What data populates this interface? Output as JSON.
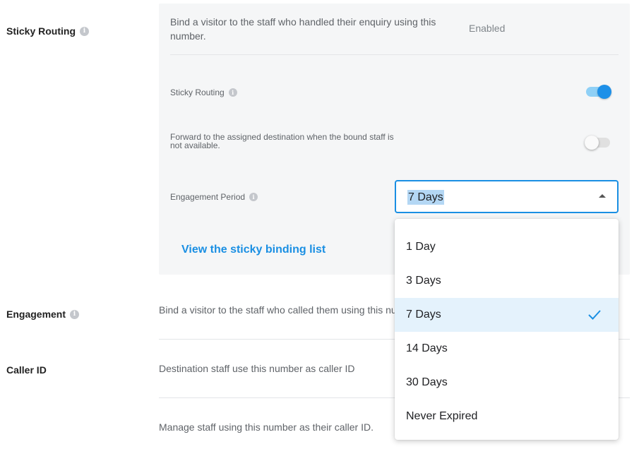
{
  "sticky_routing": {
    "section_label": "Sticky Routing",
    "description": "Bind a visitor to the staff who handled their enquiry using this number.",
    "status": "Enabled",
    "toggle_label": "Sticky Routing",
    "toggle_on": true,
    "forward_text": "Forward to the assigned destination when the bound staff is not available.",
    "forward_on": false,
    "engagement_period_label": "Engagement Period",
    "link_label": "View the sticky binding list"
  },
  "select": {
    "value": "7 Days",
    "options": [
      "1 Day",
      "3 Days",
      "7 Days",
      "14 Days",
      "30 Days",
      "Never Expired"
    ],
    "selected_index": 2
  },
  "engagement": {
    "section_label": "Engagement",
    "description": "Bind a visitor to the staff who called them using this nu"
  },
  "caller_id": {
    "section_label": "Caller ID",
    "description": "Destination staff use this number as caller ID",
    "manage_text": "Manage staff using this number as their caller ID."
  },
  "icons": {
    "info": "info-icon",
    "check": "check-icon",
    "caret": "caret-up-icon"
  },
  "colors": {
    "accent": "#1a8fe3",
    "panel_bg": "#f5f6f7",
    "selected_bg": "#e4f2fc"
  }
}
